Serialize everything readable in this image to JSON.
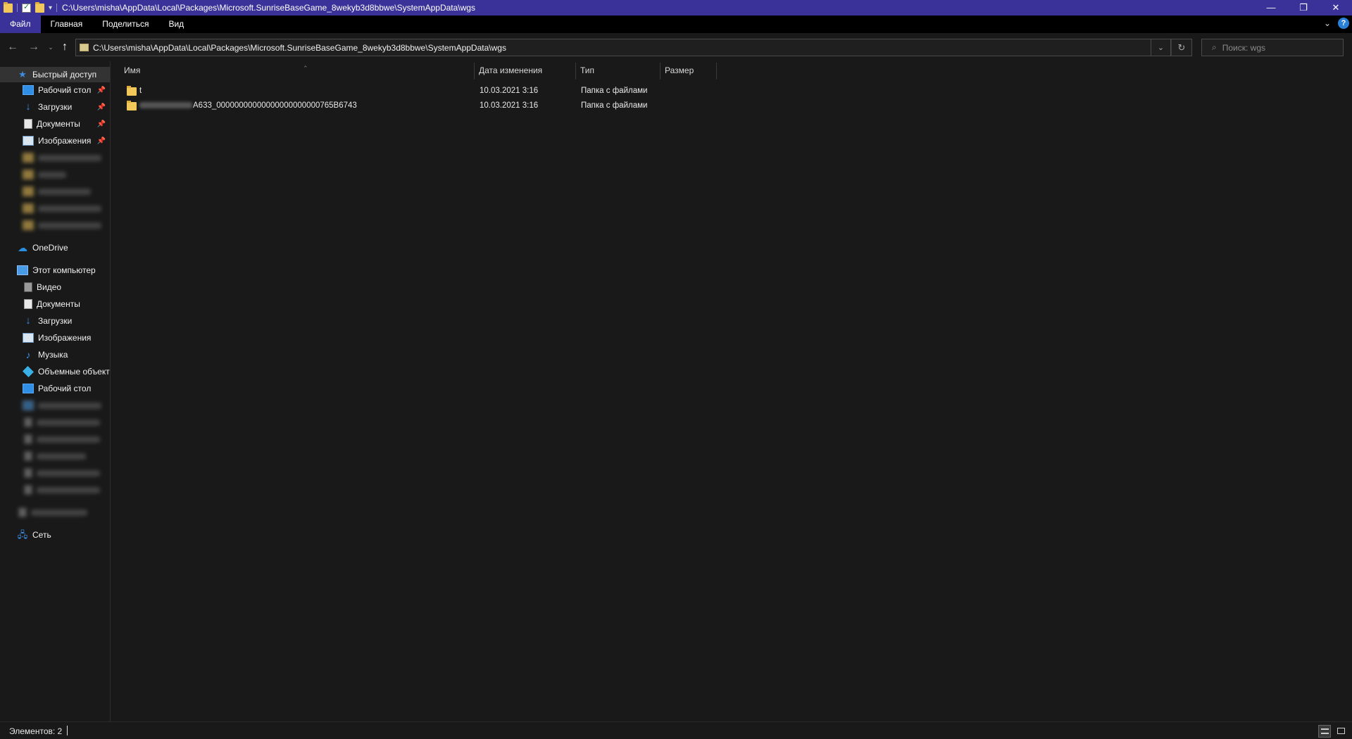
{
  "window": {
    "title": "C:\\Users\\misha\\AppData\\Local\\Packages\\Microsoft.SunriseBaseGame_8wekyb3d8bbwe\\SystemAppData\\wgs",
    "controls": {
      "minimize": "—",
      "maximize": "❐",
      "close": "✕"
    }
  },
  "ribbon": {
    "tabs": [
      {
        "label": "Файл"
      },
      {
        "label": "Главная"
      },
      {
        "label": "Поделиться"
      },
      {
        "label": "Вид"
      }
    ]
  },
  "address": {
    "path": "C:\\Users\\misha\\AppData\\Local\\Packages\\Microsoft.SunriseBaseGame_8wekyb3d8bbwe\\SystemAppData\\wgs"
  },
  "search": {
    "placeholder": "Поиск: wgs"
  },
  "sidebar": {
    "quick_access": "Быстрый доступ",
    "pinned": [
      {
        "label": "Рабочий стол",
        "icon": "desktop-icon"
      },
      {
        "label": "Загрузки",
        "icon": "download-icon"
      },
      {
        "label": "Документы",
        "icon": "documents-icon"
      },
      {
        "label": "Изображения",
        "icon": "pictures-icon"
      }
    ],
    "onedrive": "OneDrive",
    "this_pc": "Этот компьютер",
    "pc_items": [
      {
        "label": "Видео",
        "icon": "video-icon"
      },
      {
        "label": "Документы",
        "icon": "documents-icon"
      },
      {
        "label": "Загрузки",
        "icon": "download-icon"
      },
      {
        "label": "Изображения",
        "icon": "pictures-icon"
      },
      {
        "label": "Музыка",
        "icon": "music-icon"
      },
      {
        "label": "Объемные объекты",
        "icon": "3d-objects-icon"
      },
      {
        "label": "Рабочий стол",
        "icon": "desktop-icon"
      }
    ],
    "network": "Сеть"
  },
  "columns": {
    "name": "Имя",
    "date": "Дата изменения",
    "type": "Тип",
    "size": "Размер"
  },
  "files": [
    {
      "name": "t",
      "date": "10.03.2021 3:16",
      "type": "Папка с файлами",
      "size": ""
    },
    {
      "name": "A633_00000000000000000000000765B6743",
      "date": "10.03.2021 3:16",
      "type": "Папка с файлами",
      "size": ""
    }
  ],
  "status": {
    "items_count": "Элементов: 2"
  },
  "colors": {
    "titlebar": "#3a3299",
    "background": "#191919",
    "folder": "#f3c85a",
    "accent_blue": "#3d8ee0"
  }
}
